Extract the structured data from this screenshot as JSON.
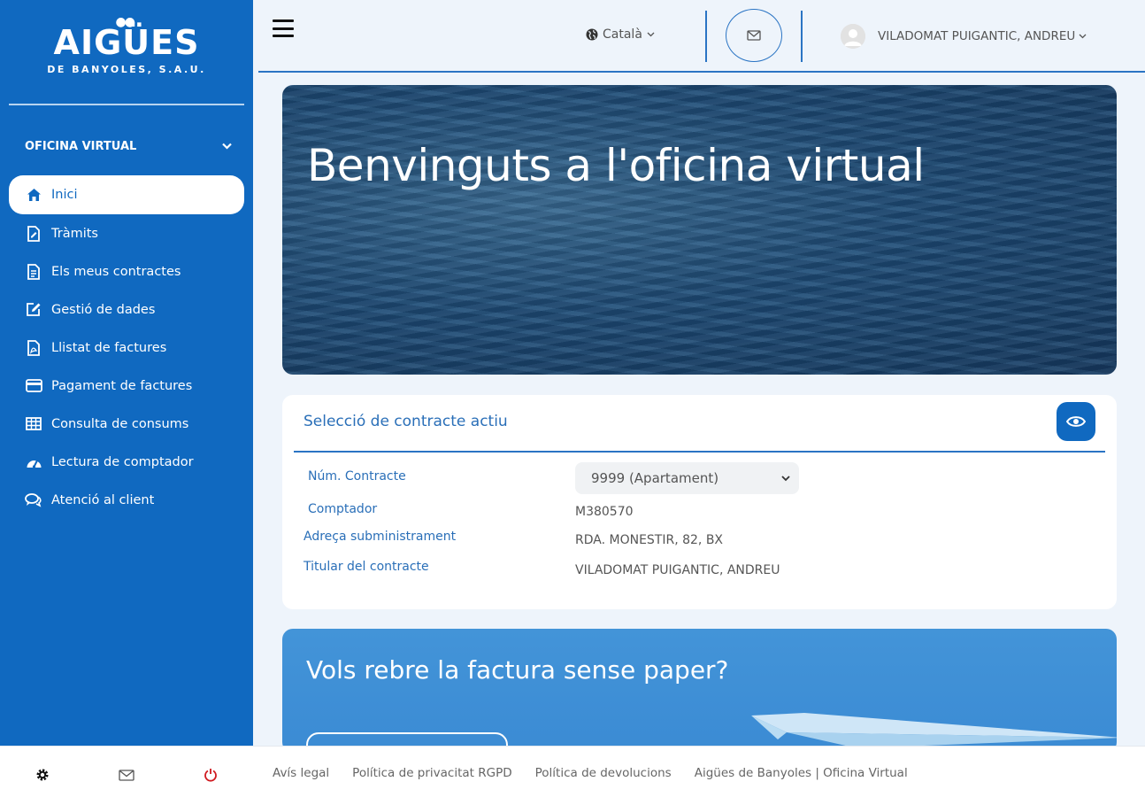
{
  "brand": {
    "name": "AIGÜES",
    "sub": "DE BANYOLES, S.A.U."
  },
  "sidebar": {
    "section_title": "OFICINA VIRTUAL",
    "items": [
      {
        "label": "Inici",
        "icon": "home-icon"
      },
      {
        "label": "Tràmits",
        "icon": "document-edit-icon"
      },
      {
        "label": "Els meus contractes",
        "icon": "contract-icon"
      },
      {
        "label": "Gestió de dades",
        "icon": "edit-icon"
      },
      {
        "label": "Llistat de factures",
        "icon": "pdf-icon"
      },
      {
        "label": "Pagament de factures",
        "icon": "credit-card-icon"
      },
      {
        "label": "Consulta de consums",
        "icon": "table-icon"
      },
      {
        "label": "Lectura de comptador",
        "icon": "gauge-icon"
      },
      {
        "label": "Atenció al client",
        "icon": "chat-icon"
      }
    ]
  },
  "header": {
    "language": "Català",
    "user": "VILADOMAT PUIGANTIC, ANDREU"
  },
  "hero": {
    "title": "Benvinguts a l'oficina virtual"
  },
  "contract": {
    "title": "Selecció de contracte actiu",
    "labels": {
      "number": "Núm. Contracte",
      "meter": "Comptador",
      "address": "Adreça subministrament",
      "holder": "Titular del contracte"
    },
    "selected": "9999 (Apartament)",
    "meter": "M380570",
    "address": "RDA. MONESTIR, 82, BX",
    "holder": "VILADOMAT PUIGANTIC, ANDREU"
  },
  "promo": {
    "title": "Vols rebre la factura sense paper?"
  },
  "footer": {
    "links": [
      "Avís legal",
      "Política de privacitat RGPD",
      "Política de devolucions",
      "Aigües de Banyoles | Oficina Virtual"
    ]
  },
  "colors": {
    "primary": "#1069c0",
    "accent": "#2a74c4",
    "power": "#d0191f"
  }
}
